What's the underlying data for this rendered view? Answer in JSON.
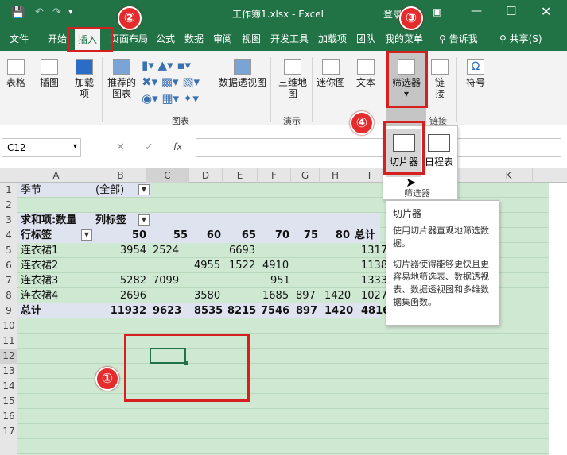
{
  "title": {
    "doc": "工作簿1.xlsx - Excel",
    "login": "登录"
  },
  "tabs": [
    "文件",
    "开始",
    "插入",
    "页面布局",
    "公式",
    "数据",
    "审阅",
    "视图",
    "开发工具",
    "加载项",
    "团队",
    "我的菜单"
  ],
  "tell_me": "告诉我",
  "share": "共享(S)",
  "ribbon": {
    "table": "表格",
    "illustrations": "插图",
    "addins": "加载项",
    "rec_charts_1": "推荐的",
    "rec_charts_2": "图表",
    "pivot_chart": "数据透视图",
    "map3d_1": "三维地",
    "map3d_2": "图",
    "sparkline": "迷你图",
    "text": "文本",
    "filter": "筛选器",
    "link_1": "链",
    "link_2": "接",
    "symbol": "符号",
    "grp_charts": "图表",
    "grp_tour": "演示",
    "grp_links": "链接"
  },
  "dropdown": {
    "slicer": "切片器",
    "timeline": "日程表",
    "group": "筛选器"
  },
  "tooltip": {
    "title": "切片器",
    "p1": "使用切片器直观地筛选数据。",
    "p2": "切片器使得能够更快且更容易地筛选表、数据透视表、数据透视图和多维数据集函数。"
  },
  "namebox": "C12",
  "fx": "fx",
  "columns": [
    "A",
    "B",
    "C",
    "D",
    "E",
    "F",
    "G",
    "H",
    "I",
    "K"
  ],
  "rows": [
    "1",
    "2",
    "3",
    "4",
    "5",
    "6",
    "7",
    "8",
    "9",
    "10",
    "11",
    "12",
    "13",
    "14",
    "15",
    "16",
    "17"
  ],
  "pivot": {
    "filter_label": "季节",
    "filter_value": "(全部)",
    "sum_label": "求和项:数量",
    "col_label": "列标签",
    "row_label": "行标签",
    "headers": [
      "50",
      "55",
      "60",
      "65",
      "70",
      "75",
      "80",
      "总计"
    ],
    "data": [
      {
        "name": "连衣裙1",
        "v": [
          "3954",
          "2524",
          "",
          "6693",
          "",
          "",
          "",
          "1317"
        ]
      },
      {
        "name": "连衣裙2",
        "v": [
          "",
          "",
          "4955",
          "1522",
          "4910",
          "",
          "",
          "1138"
        ]
      },
      {
        "name": "连衣裙3",
        "v": [
          "5282",
          "7099",
          "",
          "",
          "951",
          "",
          "",
          "1333"
        ]
      },
      {
        "name": "连衣裙4",
        "v": [
          "2696",
          "",
          "3580",
          "",
          "1685",
          "897",
          "1420",
          "1027"
        ]
      }
    ],
    "total": {
      "name": "总计",
      "v": [
        "11932",
        "9623",
        "8535",
        "8215",
        "7546",
        "897",
        "1420",
        "4816"
      ]
    }
  },
  "callouts": [
    "①",
    "②",
    "③",
    "④"
  ]
}
